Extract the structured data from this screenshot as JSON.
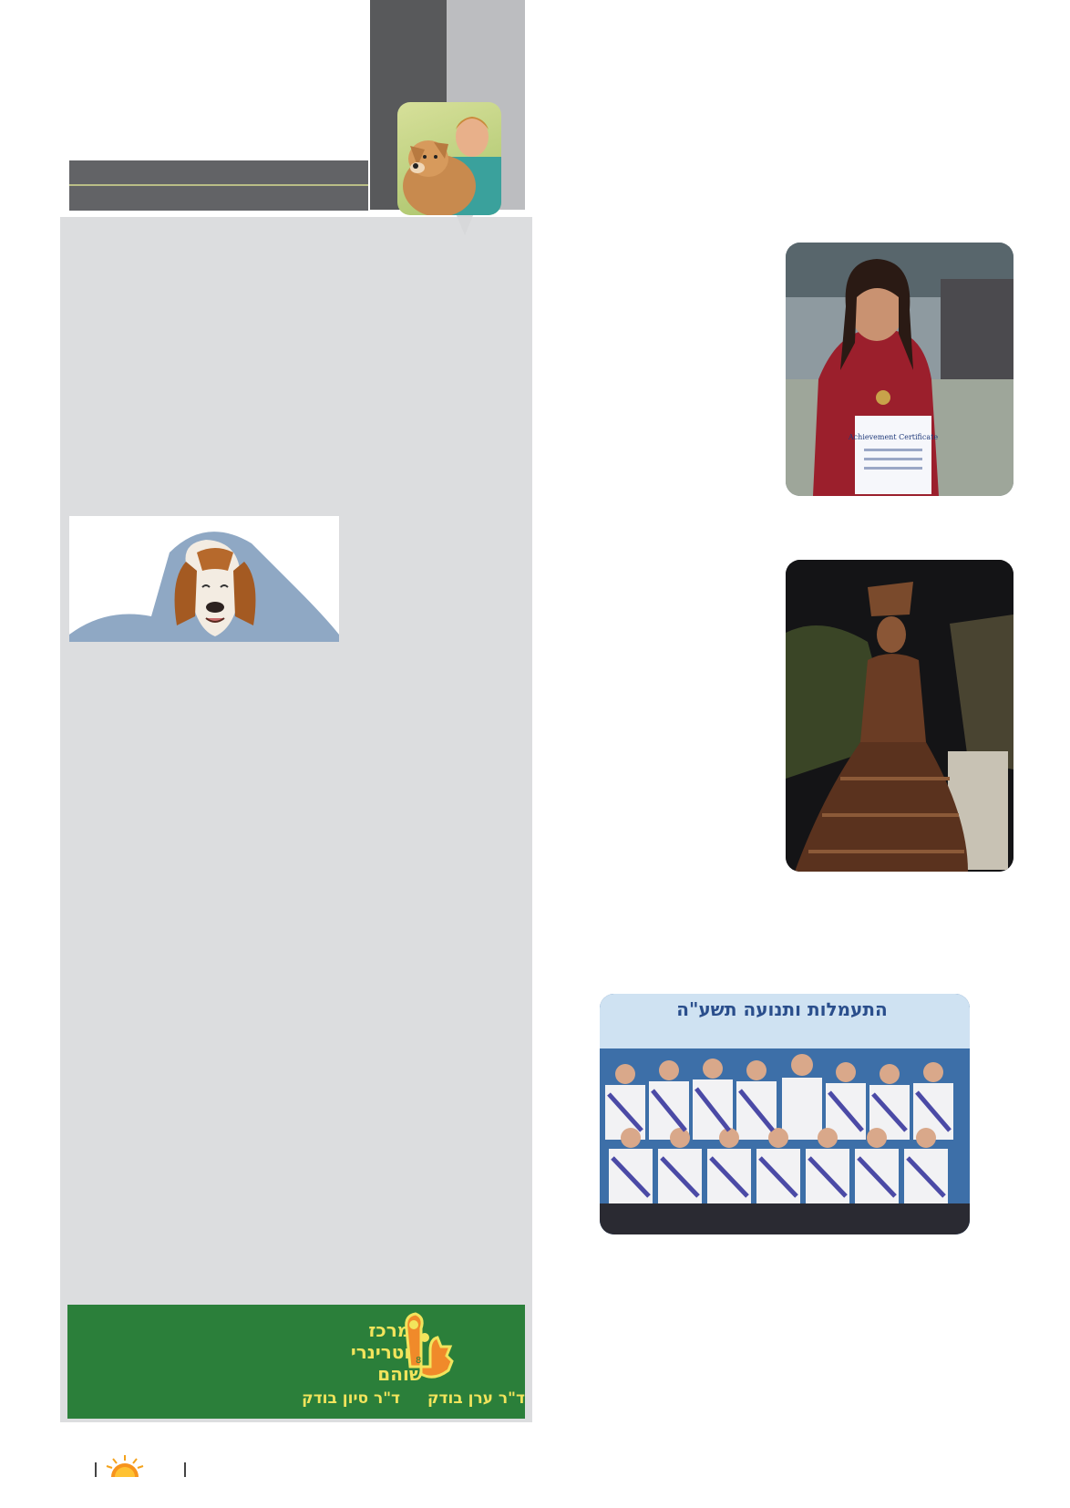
{
  "header": {
    "colors": {
      "dark_bar": "#58595b",
      "light_bar": "#bcbdc0",
      "title_band": "#626366",
      "rule": "#b9bd86"
    }
  },
  "column": {
    "background": "#dcdddf"
  },
  "ad": {
    "title_lines": [
      "המרכז",
      "הוטרינרי",
      "שוהם"
    ],
    "doctors": [
      "ד\"ר ערן בודק",
      "ד\"ר סיון בודק"
    ],
    "colors": {
      "background": "#2b7f3a",
      "text": "#f2e45c"
    }
  },
  "photos": {
    "certificate_text": "Achievement Certificate",
    "banner_text": "התעמלות ותנועה תשע\"ה"
  }
}
